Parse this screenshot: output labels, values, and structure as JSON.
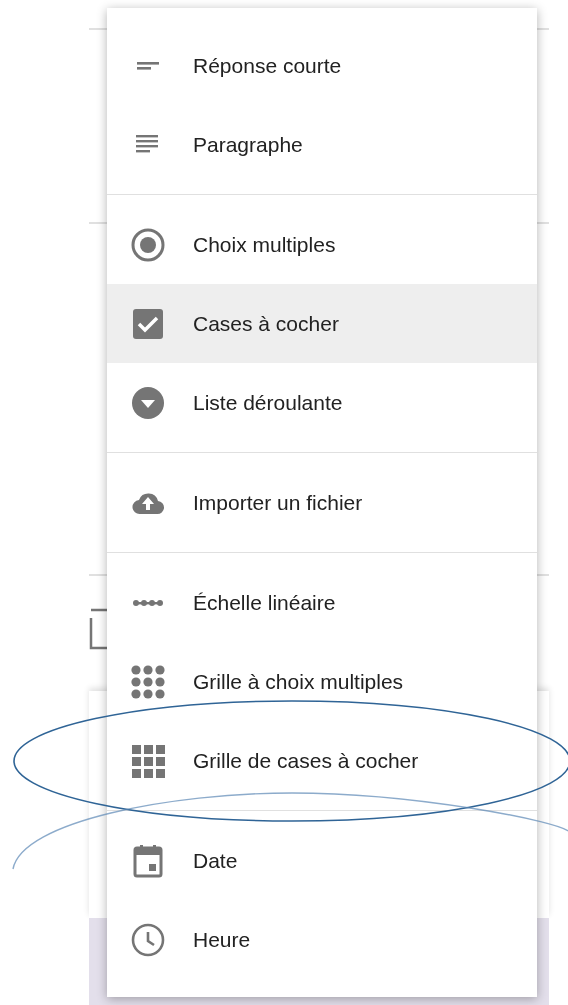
{
  "menu": {
    "groups": [
      {
        "items": [
          {
            "kind": "short",
            "label": "Réponse courte",
            "selected": false
          },
          {
            "kind": "paragraph",
            "label": "Paragraphe",
            "selected": false
          }
        ]
      },
      {
        "items": [
          {
            "kind": "radio",
            "label": "Choix multiples",
            "selected": false
          },
          {
            "kind": "checkbox",
            "label": "Cases à cocher",
            "selected": true
          },
          {
            "kind": "dropdown",
            "label": "Liste déroulante",
            "selected": false
          }
        ]
      },
      {
        "items": [
          {
            "kind": "upload",
            "label": "Importer un fichier",
            "selected": false
          }
        ]
      },
      {
        "items": [
          {
            "kind": "scale",
            "label": "Échelle linéaire",
            "selected": false
          },
          {
            "kind": "radiogrid",
            "label": "Grille à choix multiples",
            "selected": false
          },
          {
            "kind": "checkgrid",
            "label": "Grille de cases à cocher",
            "selected": false,
            "circled": true
          }
        ]
      },
      {
        "items": [
          {
            "kind": "date",
            "label": "Date",
            "selected": false,
            "arc_above": true
          },
          {
            "kind": "time",
            "label": "Heure",
            "selected": false
          }
        ]
      }
    ]
  }
}
